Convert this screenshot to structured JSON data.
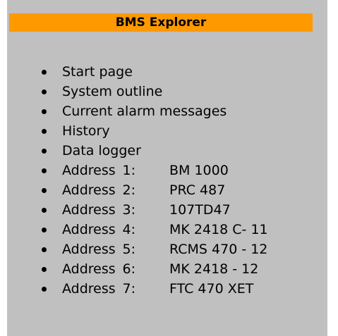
{
  "title": "BMS Explorer",
  "nav_links": [
    {
      "label": "Start page"
    },
    {
      "label": "System outline"
    },
    {
      "label": "Current alarm messages"
    },
    {
      "label": "History"
    },
    {
      "label": "Data logger"
    }
  ],
  "addresses": [
    {
      "label": "Address",
      "number": "1:",
      "device": "BM 1000"
    },
    {
      "label": "Address",
      "number": "2:",
      "device": "PRC 487"
    },
    {
      "label": "Address",
      "number": "3:",
      "device": "107TD47"
    },
    {
      "label": "Address",
      "number": "4:",
      "device": "MK 2418 C- 11"
    },
    {
      "label": "Address",
      "number": "5:",
      "device": "RCMS 470 - 12"
    },
    {
      "label": "Address",
      "number": "6:",
      "device": "MK 2418 - 12"
    },
    {
      "label": "Address",
      "number": "7:",
      "device": "FTC 470 XET"
    }
  ],
  "colors": {
    "background": "#c0c0c0",
    "title_bar": "#ff9900",
    "text": "#000000"
  }
}
